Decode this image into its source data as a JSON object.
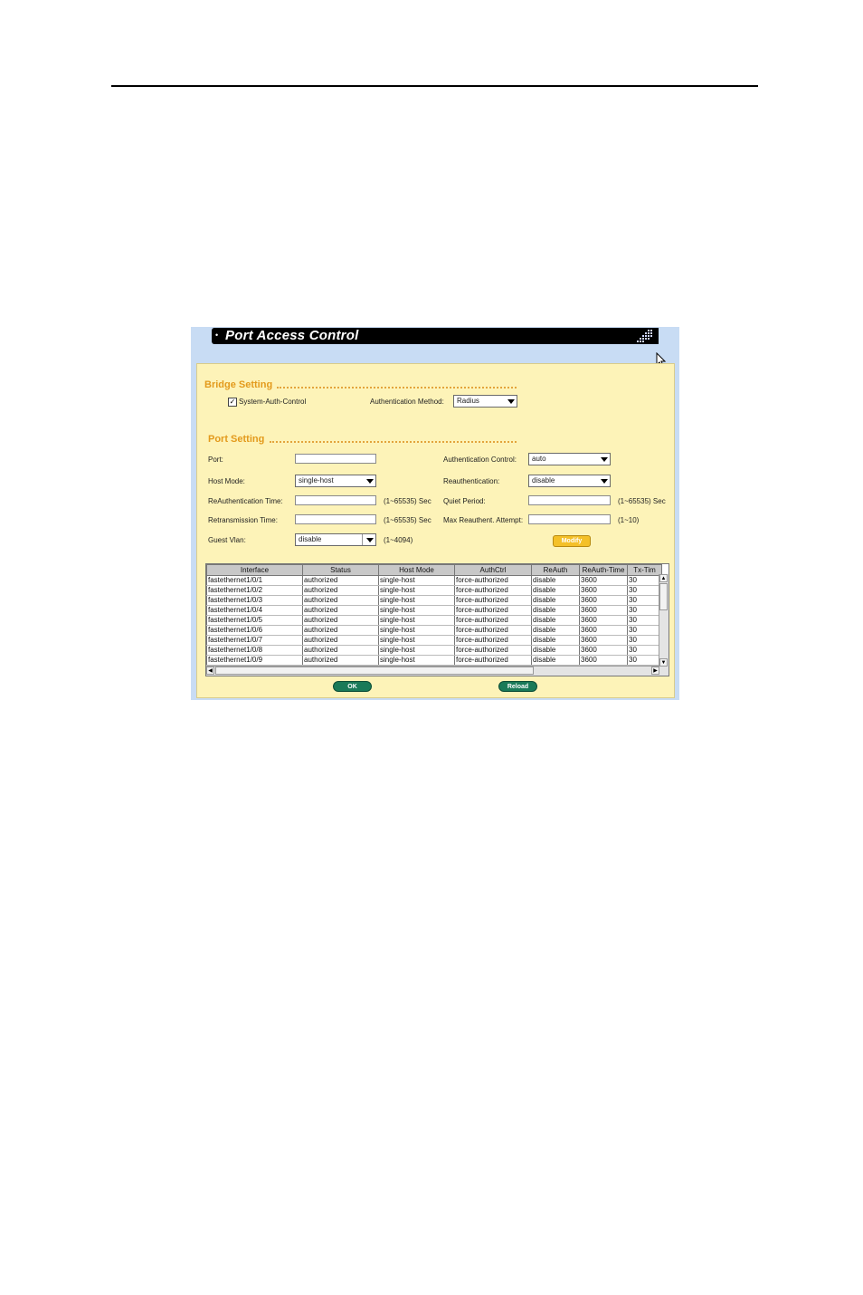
{
  "window": {
    "title": "Port Access Control"
  },
  "bridge_setting": {
    "title": "Bridge Setting",
    "system_auth_control_label": "System-Auth-Control",
    "system_auth_control_checked": true,
    "auth_method_label": "Authentication Method:",
    "auth_method_value": "Radius"
  },
  "port_setting": {
    "title": "Port Setting",
    "port_label": "Port:",
    "port_value": "",
    "host_mode_label": "Host Mode:",
    "host_mode_value": "single-host",
    "reauth_time_label": "ReAuthentication Time:",
    "reauth_time_value": "",
    "reauth_time_range": "(1~65535) Sec",
    "retrans_time_label": "Retransmission Time:",
    "retrans_time_value": "",
    "retrans_time_range": "(1~65535) Sec",
    "guest_vlan_label": "Guest Vlan:",
    "guest_vlan_value": "disable",
    "guest_vlan_range": "(1~4094)",
    "auth_control_label": "Authentication Control:",
    "auth_control_value": "auto",
    "reauthentication_label": "Reauthentication:",
    "reauthentication_value": "disable",
    "quiet_period_label": "Quiet Period:",
    "quiet_period_value": "",
    "quiet_period_range": "(1~65535) Sec",
    "max_reauth_label": "Max Reauthent. Attempt:",
    "max_reauth_value": "",
    "max_reauth_range": "(1~10)",
    "modify_label": "Modify"
  },
  "table": {
    "columns": [
      "Interface",
      "Status",
      "Host Mode",
      "AuthCtrl",
      "ReAuth",
      "ReAuth-Time",
      "Tx-Tim"
    ],
    "rows": [
      [
        "fastethernet1/0/1",
        "authorized",
        "single-host",
        "force-authorized",
        "disable",
        "3600",
        "30"
      ],
      [
        "fastethernet1/0/2",
        "authorized",
        "single-host",
        "force-authorized",
        "disable",
        "3600",
        "30"
      ],
      [
        "fastethernet1/0/3",
        "authorized",
        "single-host",
        "force-authorized",
        "disable",
        "3600",
        "30"
      ],
      [
        "fastethernet1/0/4",
        "authorized",
        "single-host",
        "force-authorized",
        "disable",
        "3600",
        "30"
      ],
      [
        "fastethernet1/0/5",
        "authorized",
        "single-host",
        "force-authorized",
        "disable",
        "3600",
        "30"
      ],
      [
        "fastethernet1/0/6",
        "authorized",
        "single-host",
        "force-authorized",
        "disable",
        "3600",
        "30"
      ],
      [
        "fastethernet1/0/7",
        "authorized",
        "single-host",
        "force-authorized",
        "disable",
        "3600",
        "30"
      ],
      [
        "fastethernet1/0/8",
        "authorized",
        "single-host",
        "force-authorized",
        "disable",
        "3600",
        "30"
      ],
      [
        "fastethernet1/0/9",
        "authorized",
        "single-host",
        "force-authorized",
        "disable",
        "3600",
        "30"
      ]
    ]
  },
  "buttons": {
    "ok_label": "OK",
    "reload_label": "Reload"
  },
  "icons": {
    "title_bullet": "bullet-icon",
    "title_logo": "brand-logo-icon",
    "cursor": "mouse-pointer-icon",
    "scroll_up": "arrow-up-icon",
    "scroll_down": "arrow-down-icon",
    "scroll_left": "arrow-left-icon",
    "scroll_right": "arrow-right-icon"
  },
  "colors": {
    "panel_bg": "#fdf3b8",
    "section_title": "#e39a1c",
    "frame_bg": "#c8dcf4",
    "button_green": "#1a7a58",
    "button_modify": "#f4c028"
  }
}
